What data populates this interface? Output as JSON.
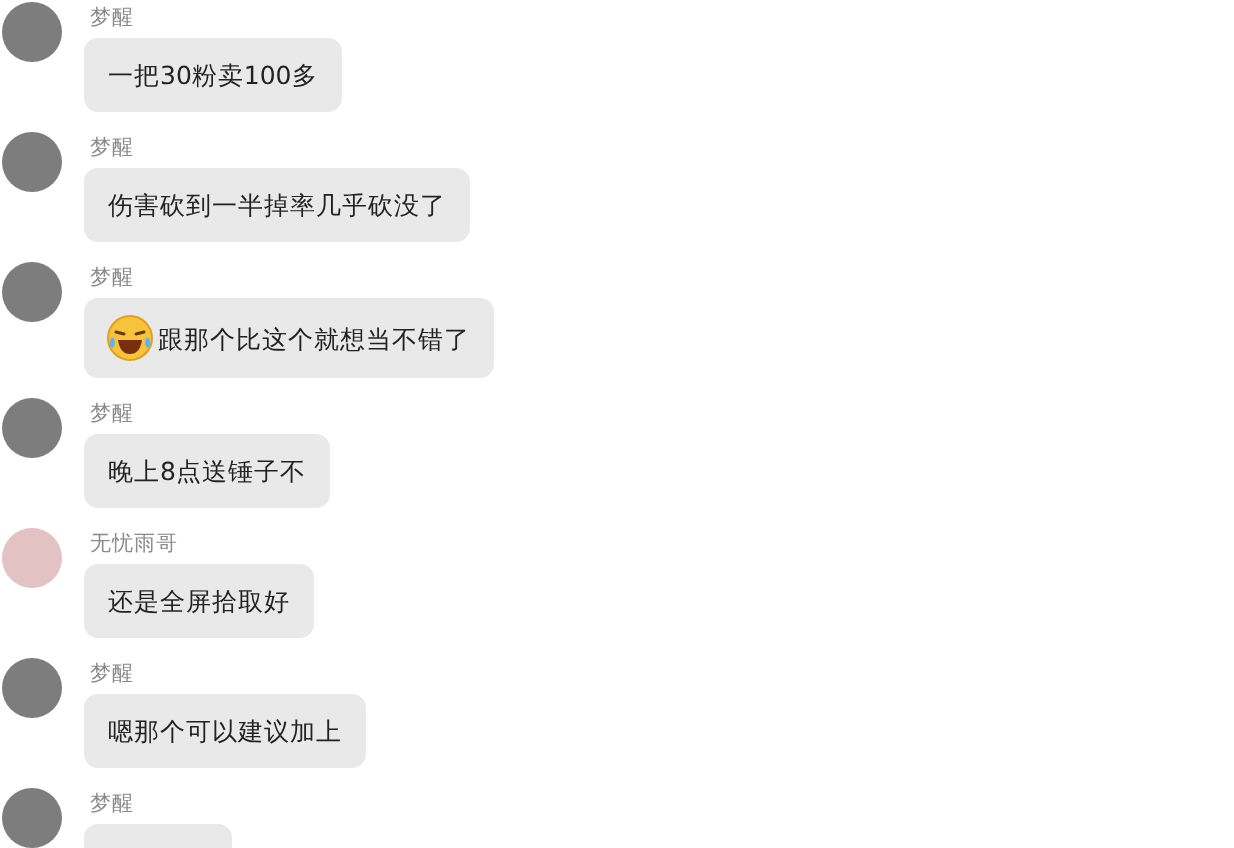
{
  "messages": [
    {
      "author": "梦醒",
      "color": "#7d7d7d",
      "emoji": false,
      "text": "一把30粉卖100多"
    },
    {
      "author": "梦醒",
      "color": "#7d7d7d",
      "emoji": false,
      "text": "伤害砍到一半掉率几乎砍没了"
    },
    {
      "author": "梦醒",
      "color": "#7d7d7d",
      "emoji": true,
      "text": "跟那个比这个就想当不错了"
    },
    {
      "author": "梦醒",
      "color": "#7d7d7d",
      "emoji": false,
      "text": "晚上8点送锤子不"
    },
    {
      "author": "无忧雨哥",
      "color": "#e3c2c4",
      "emoji": false,
      "text": "还是全屏拾取好"
    },
    {
      "author": "梦醒",
      "color": "#7d7d7d",
      "emoji": false,
      "text": "嗯那个可以建议加上"
    },
    {
      "author": "梦醒",
      "color": "#7d7d7d",
      "emoji": false
    }
  ]
}
